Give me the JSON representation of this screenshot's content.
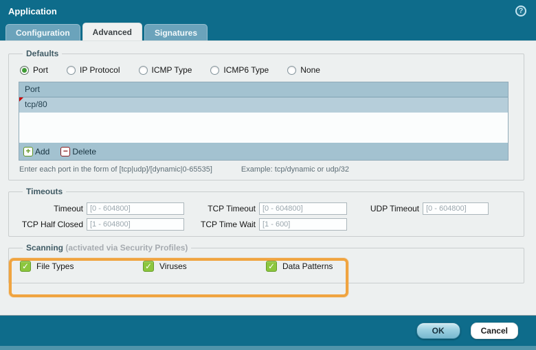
{
  "window": {
    "title": "Application"
  },
  "icons": {
    "help": "?",
    "add": "+",
    "delete": "−",
    "check": "✓"
  },
  "tabs": [
    {
      "label": "Configuration",
      "active": false
    },
    {
      "label": "Advanced",
      "active": true
    },
    {
      "label": "Signatures",
      "active": false
    }
  ],
  "defaults": {
    "legend": "Defaults",
    "radios": [
      {
        "label": "Port",
        "selected": true
      },
      {
        "label": "IP Protocol",
        "selected": false
      },
      {
        "label": "ICMP Type",
        "selected": false
      },
      {
        "label": "ICMP6 Type",
        "selected": false
      },
      {
        "label": "None",
        "selected": false
      }
    ],
    "table": {
      "header": "Port",
      "rows": [
        "tcp/80"
      ],
      "add_label": "Add",
      "delete_label": "Delete"
    },
    "hint": "Enter each port in the form of [tcp|udp]/[dynamic|0-65535]",
    "hint_example": "Example: tcp/dynamic or udp/32"
  },
  "timeouts": {
    "legend": "Timeouts",
    "fields": [
      {
        "label": "Timeout",
        "placeholder": "[0 - 604800]",
        "value": ""
      },
      {
        "label": "TCP Timeout",
        "placeholder": "[0 - 604800]",
        "value": ""
      },
      {
        "label": "UDP Timeout",
        "placeholder": "[0 - 604800]",
        "value": ""
      },
      {
        "label": "TCP Half Closed",
        "placeholder": "[1 - 604800]",
        "value": ""
      },
      {
        "label": "TCP Time Wait",
        "placeholder": "[1 - 600]",
        "value": ""
      }
    ]
  },
  "scanning": {
    "legend": "Scanning",
    "legend_note": "(activated via Security Profiles)",
    "checkboxes": [
      {
        "label": "File Types",
        "checked": true
      },
      {
        "label": "Viruses",
        "checked": true
      },
      {
        "label": "Data Patterns",
        "checked": true
      }
    ]
  },
  "footer": {
    "ok_label": "OK",
    "cancel_label": "Cancel"
  },
  "colors": {
    "frame_teal": "#0e6c8b",
    "highlight_orange": "#f0a440",
    "check_green": "#8cc63e",
    "radio_green": "#3f9c35"
  }
}
